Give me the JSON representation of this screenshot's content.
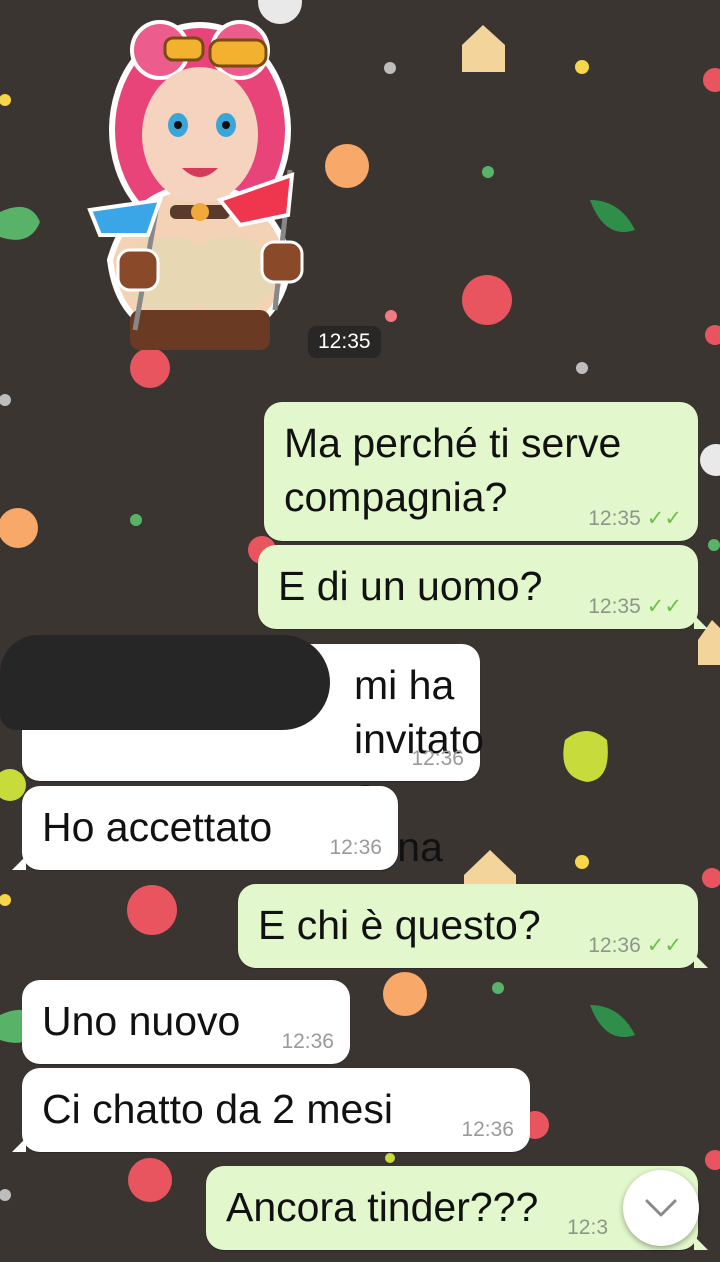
{
  "sticker": {
    "icon": "girl-with-flags-sticker",
    "time": "12:35"
  },
  "messages": [
    {
      "direction": "out",
      "text": "Ma perché ti serve\ncompagnia?",
      "time": "12:35",
      "status": "read"
    },
    {
      "direction": "out",
      "text": "E di un uomo?",
      "time": "12:35",
      "status": "read"
    },
    {
      "direction": "in",
      "text": "mi ha\ninvitato a cena",
      "time": "12:36"
    },
    {
      "direction": "in",
      "text": "Ho accettato",
      "time": "12:36"
    },
    {
      "direction": "out",
      "text": "E chi è questo?",
      "time": "12:36",
      "status": "read"
    },
    {
      "direction": "in",
      "text": "Uno nuovo",
      "time": "12:36"
    },
    {
      "direction": "in",
      "text": "Ci chatto da 2 mesi",
      "time": "12:36"
    },
    {
      "direction": "out",
      "text": "Ancora tinder???",
      "time": "12:3",
      "status": "read"
    }
  ],
  "ticks_glyph": "✓✓",
  "colors": {
    "background": "#3b3532",
    "outgoing_bubble": "#e2f7cb",
    "incoming_bubble": "#ffffff",
    "read_ticks": "#6cc04a"
  },
  "scroll_button": {
    "icon": "chevron-down-icon"
  }
}
